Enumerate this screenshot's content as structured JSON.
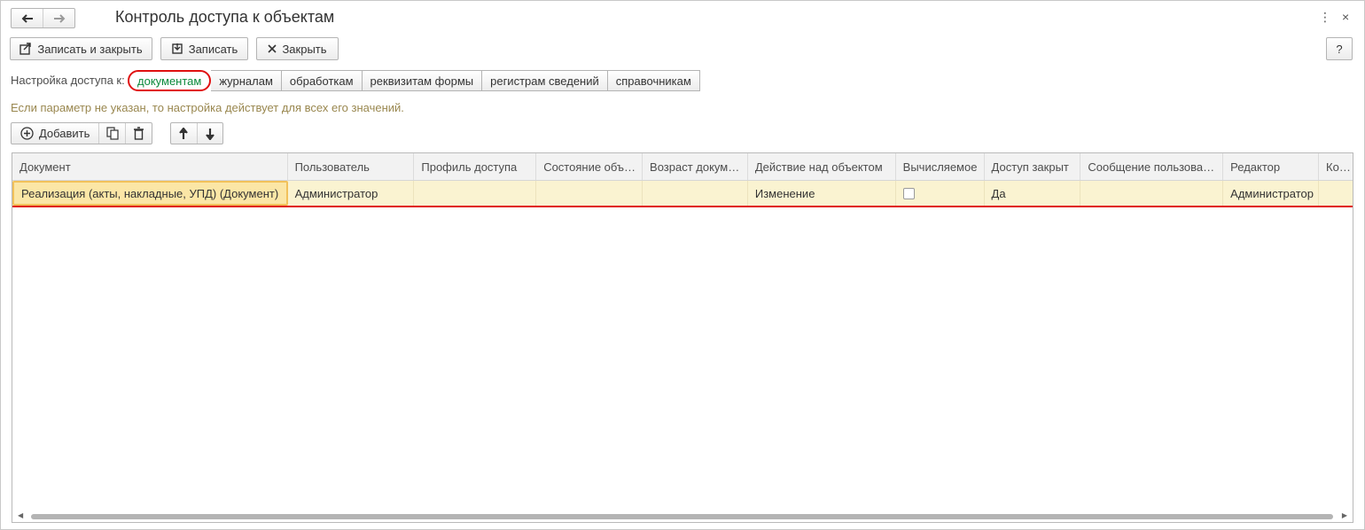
{
  "window": {
    "title": "Контроль доступа к объектам",
    "more_glyph": "⋮",
    "close_glyph": "×"
  },
  "nav": {
    "back_glyph": "🡐",
    "forward_glyph": "🡒"
  },
  "toolbar": {
    "save_close_label": "Записать и закрыть",
    "save_label": "Записать",
    "close_label": "Закрыть",
    "help_label": "?"
  },
  "access": {
    "label": "Настройка доступа к:",
    "tabs": [
      {
        "label": "документам",
        "active": true
      },
      {
        "label": "журналам"
      },
      {
        "label": "обработкам"
      },
      {
        "label": "реквизитам формы"
      },
      {
        "label": "регистрам сведений"
      },
      {
        "label": "справочникам"
      }
    ]
  },
  "hint": "Если параметр не указан, то настройка действует для всех его значений.",
  "grid_toolbar": {
    "add_label": "Добавить"
  },
  "table": {
    "columns": [
      "Документ",
      "Пользователь",
      "Профиль доступа",
      "Состояние объ…",
      "Возраст докум…",
      "Действие над объектом",
      "Вычисляемое",
      "Доступ закрыт",
      "Сообщение пользова…",
      "Редактор",
      "Ко…"
    ],
    "rows": [
      {
        "document": "Реализация (акты, накладные, УПД) (Документ)",
        "user": "Администратор",
        "profile": "",
        "state": "",
        "age": "",
        "action": "Изменение",
        "computed": false,
        "access_closed": "Да",
        "message": "",
        "editor": "Администратор",
        "extra": ""
      }
    ]
  },
  "colors": {
    "active_tab_text": "#0c8a3c",
    "highlight_outline": "#e01010",
    "hint_text": "#99874f",
    "selected_row": "#faf3d1"
  }
}
